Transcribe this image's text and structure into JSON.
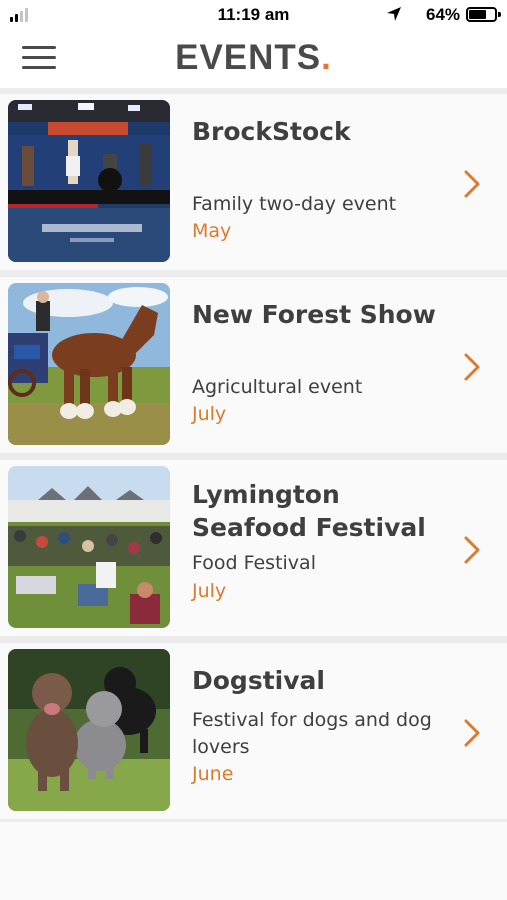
{
  "status_bar": {
    "time": "11:19 am",
    "battery": "64%",
    "battery_level": 0.64,
    "signal_bars_active": 2,
    "signal_bars_total": 4,
    "location_icon": "location-arrow-icon"
  },
  "header": {
    "title": "EVENTS",
    "title_dot": ".",
    "menu_icon": "hamburger-menu-icon",
    "accent_color": "#e0792e"
  },
  "events": [
    {
      "title": "BrockStock",
      "description": "Family two-day event",
      "month": "May",
      "image": "band-on-stage-photo"
    },
    {
      "title": "New Forest Show",
      "description": "Agricultural event",
      "month": "July",
      "image": "shire-horse-photo"
    },
    {
      "title": "Lymington Seafood Festival",
      "description": "Food Festival",
      "month": "July",
      "image": "festival-crowd-photo"
    },
    {
      "title": "Dogstival",
      "description": "Festival for dogs and dog lovers",
      "month": "June",
      "image": "dogs-running-photo"
    }
  ]
}
